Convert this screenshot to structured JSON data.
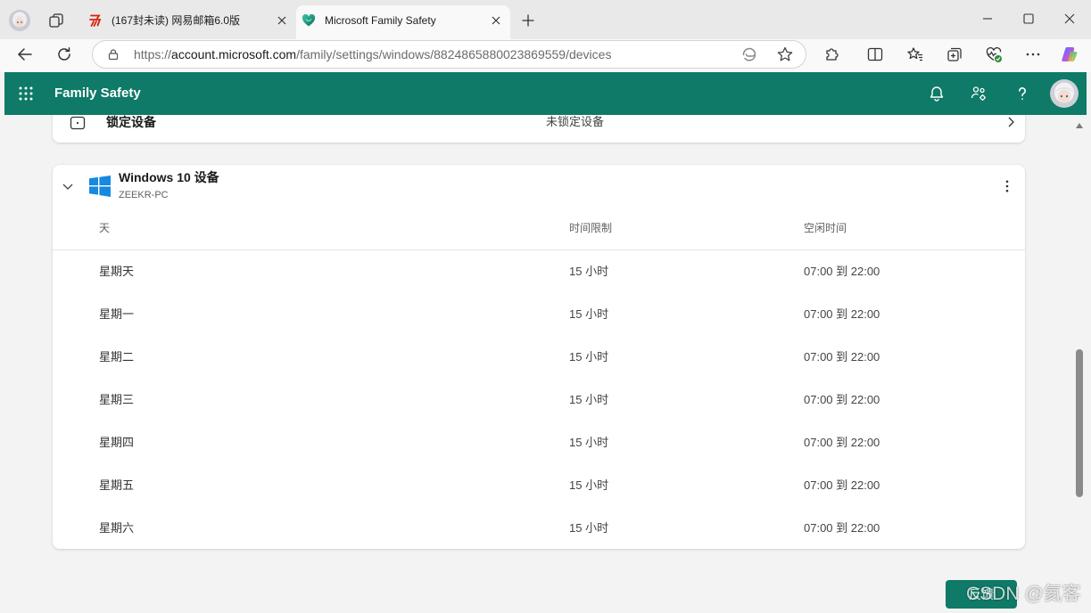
{
  "colors": {
    "brand": "#0e7a67",
    "page_bg": "#f3f3f3",
    "windows_blue": "#1689e0"
  },
  "browser": {
    "tabs": [
      {
        "title": "(167封未读) 网易邮箱6.0版",
        "icon": "netease-mail-icon",
        "active": false
      },
      {
        "title": "Microsoft Family Safety",
        "icon": "family-safety-heart-icon",
        "active": true
      }
    ],
    "url": {
      "scheme": "https://",
      "host": "account.microsoft.com",
      "path": "/family/settings/windows/8824865880023869559/devices"
    },
    "toolbar_icons": [
      "back-icon",
      "refresh-icon",
      "lock-icon",
      "edge-swirl-icon",
      "favorite-star-icon",
      "extensions-icon",
      "split-screen-icon",
      "favorites-icon",
      "collections-icon",
      "browser-essentials-icon",
      "more-icon",
      "copilot-icon"
    ]
  },
  "app_header": {
    "title": "Family Safety",
    "icons": [
      "app-launcher-icon",
      "notifications-bell-icon",
      "family-settings-icon",
      "help-icon",
      "account-avatar"
    ]
  },
  "lock_card": {
    "label": "锁定设备",
    "status": "未锁定设备"
  },
  "device_card": {
    "title": "Windows 10 设备",
    "device_name": "ZEEKR-PC",
    "columns": {
      "day": "天",
      "limit": "时间限制",
      "downtime": "空闲时间"
    },
    "rows": [
      {
        "day": "星期天",
        "limit": "15 小时",
        "downtime": "07:00 到 22:00"
      },
      {
        "day": "星期一",
        "limit": "15 小时",
        "downtime": "07:00 到 22:00"
      },
      {
        "day": "星期二",
        "limit": "15 小时",
        "downtime": "07:00 到 22:00"
      },
      {
        "day": "星期三",
        "limit": "15 小时",
        "downtime": "07:00 到 22:00"
      },
      {
        "day": "星期四",
        "limit": "15 小时",
        "downtime": "07:00 到 22:00"
      },
      {
        "day": "星期五",
        "limit": "15 小时",
        "downtime": "07:00 到 22:00"
      },
      {
        "day": "星期六",
        "limit": "15 小时",
        "downtime": "07:00 到 22:00"
      }
    ]
  },
  "feedback_button": {
    "label": "反馈"
  },
  "watermark": "CSDN @氦客"
}
